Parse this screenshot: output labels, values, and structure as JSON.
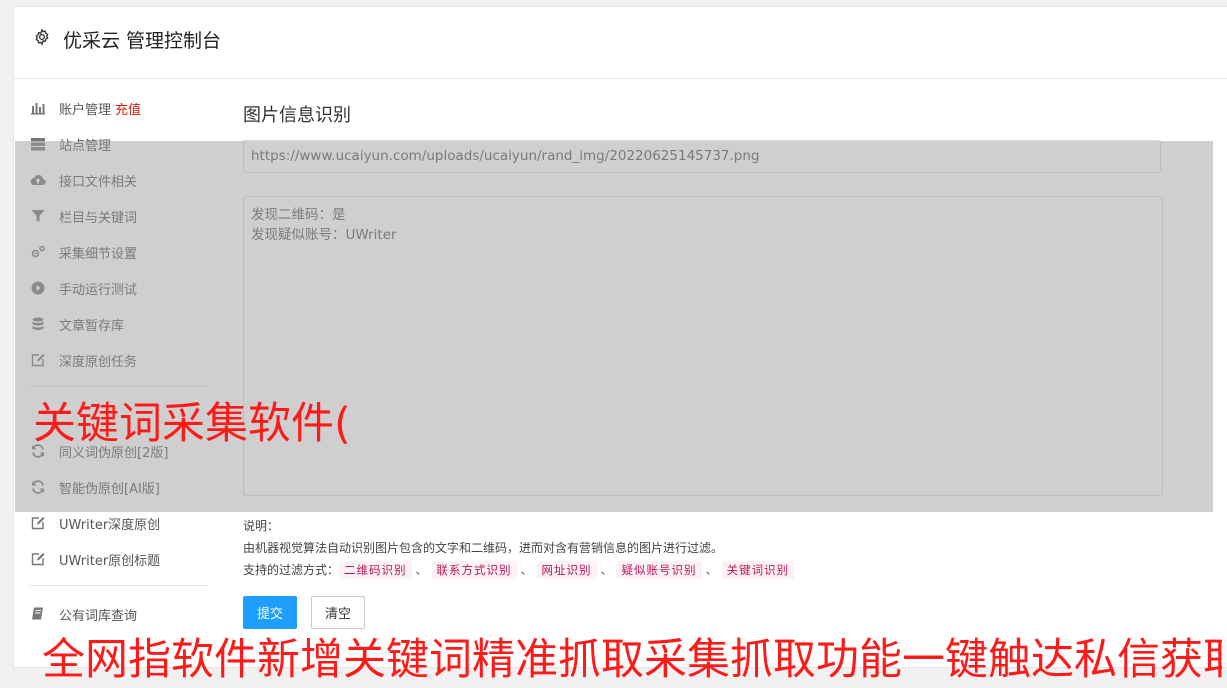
{
  "header": {
    "title": "优采云 管理控制台",
    "icon": "gear-icon"
  },
  "sidebar": {
    "items": [
      {
        "label": "账户管理",
        "badge": "充值",
        "icon": "bar-chart-icon"
      },
      {
        "label": "站点管理",
        "icon": "server-icon"
      },
      {
        "label": "接口文件相关",
        "icon": "cloud-upload-icon"
      },
      {
        "label": "栏目与关键词",
        "icon": "filter-icon"
      },
      {
        "label": "采集细节设置",
        "icon": "gears-icon"
      },
      {
        "label": "手动运行测试",
        "icon": "play-icon"
      },
      {
        "label": "文章暂存库",
        "icon": "database-icon"
      },
      {
        "label": "深度原创任务",
        "icon": "edit-icon"
      },
      {
        "label": "",
        "icon": ""
      },
      {
        "label": "同义词伪原创[2版]",
        "icon": "refresh-icon"
      },
      {
        "label": "智能伪原创[AI版]",
        "icon": "refresh-icon"
      },
      {
        "label": "UWriter深度原创",
        "icon": "edit-icon"
      },
      {
        "label": "UWriter原创标题",
        "icon": "edit-icon"
      },
      {
        "label": "公有词库查询",
        "icon": "book-icon"
      }
    ]
  },
  "main": {
    "title": "图片信息识别",
    "url_value": "https://www.ucaiyun.com/uploads/ucaiyun/rand_img/20220625145737.png",
    "result_lines": [
      "发现二维码：是",
      "发现疑似账号：UWriter"
    ],
    "desc_label": "说明：",
    "desc_text": "由机器视觉算法自动识别图片包含的文字和二维码，进而对含有营销信息的图片进行过滤。",
    "filter_label": "支持的过滤方式：",
    "filters": [
      "二维码识别",
      "联系方式识别",
      "网址识别",
      "疑似账号识别",
      "关键词识别"
    ],
    "filter_sep": "、",
    "submit_label": "提交",
    "clear_label": "清空"
  },
  "overlay": {
    "watermark_top": "关键词采集软件(",
    "watermark_bottom": "全网指软件新增关键词精准抓取采集抓取功能一键触达私信获取"
  },
  "colors": {
    "primary": "#1e9fff",
    "tag_text": "#c0135a",
    "tag_bg": "#fbf2f4",
    "watermark": "#ff1a1a",
    "badge": "#d81e06"
  }
}
